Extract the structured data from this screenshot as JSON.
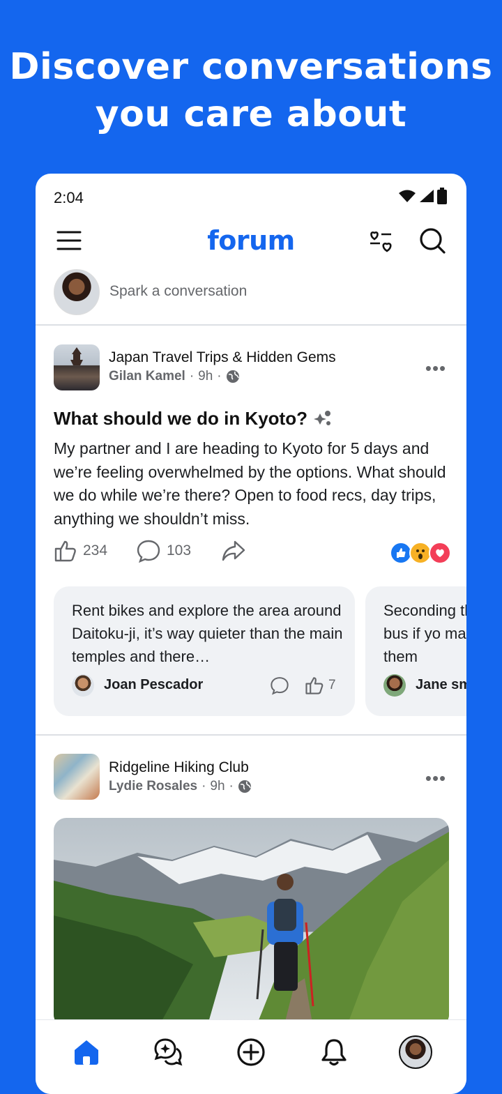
{
  "promo": {
    "headline_line1": "Discover conversations",
    "headline_line2": "you care about"
  },
  "status_bar": {
    "time": "2:04"
  },
  "app": {
    "logo": "forum",
    "brand_color": "#1466ee"
  },
  "composer": {
    "placeholder": "Spark a conversation"
  },
  "post1": {
    "group": "Japan Travel Trips & Hidden Gems",
    "author": "Gilan Kamel",
    "time": "9h",
    "visibility_icon": "globe-icon",
    "title": "What should we do in Kyoto?",
    "body": "My partner and I are heading to Kyoto for 5 days and we’re feeling overwhelmed by the options. What should we do while we’re there? Open to food recs, day trips, anything we shouldn’t miss.",
    "likes": "234",
    "comments": "103",
    "reactions": [
      "like",
      "wow",
      "love"
    ],
    "top_comments": [
      {
        "text": "Rent bikes and explore the area around Daitoku-ji, it’s way quieter than the main temples and there…",
        "author": "Joan Pescador",
        "likes": "7"
      },
      {
        "text": "Seconding the bus if yo make them",
        "author": "Jane sm"
      }
    ]
  },
  "post2": {
    "group": "Ridgeline Hiking Club",
    "author": "Lydie Rosales",
    "time": "9h",
    "visibility_icon": "globe-icon"
  },
  "nav": [
    "home",
    "conversations",
    "create",
    "notifications",
    "profile"
  ]
}
